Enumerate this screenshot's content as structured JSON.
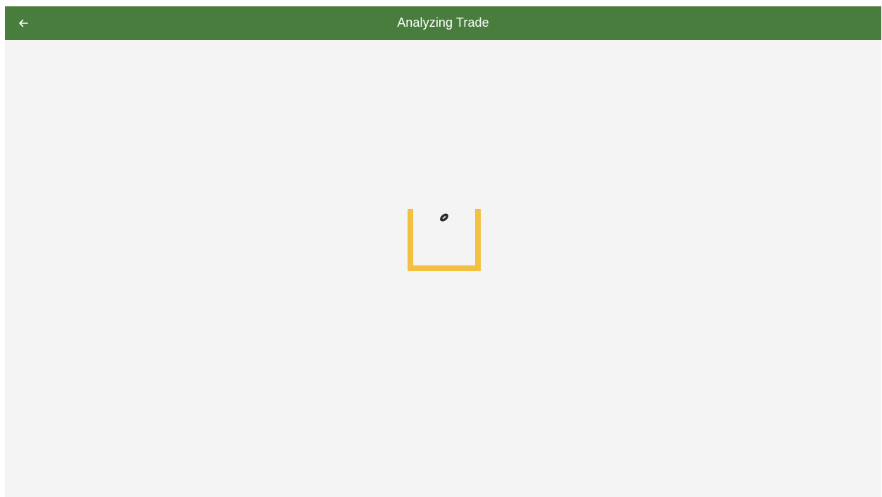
{
  "header": {
    "title": "Analyzing Trade",
    "back_icon": "arrow-left-icon",
    "background_color": "#487d3e",
    "text_color": "#ffffff"
  },
  "loader": {
    "goalpost_icon": "goalpost-icon",
    "ball_icon": "football-icon",
    "goalpost_color": "#f2c141",
    "ball_color": "#2b2b2b"
  },
  "page": {
    "background_color": "#f4f4f4"
  }
}
